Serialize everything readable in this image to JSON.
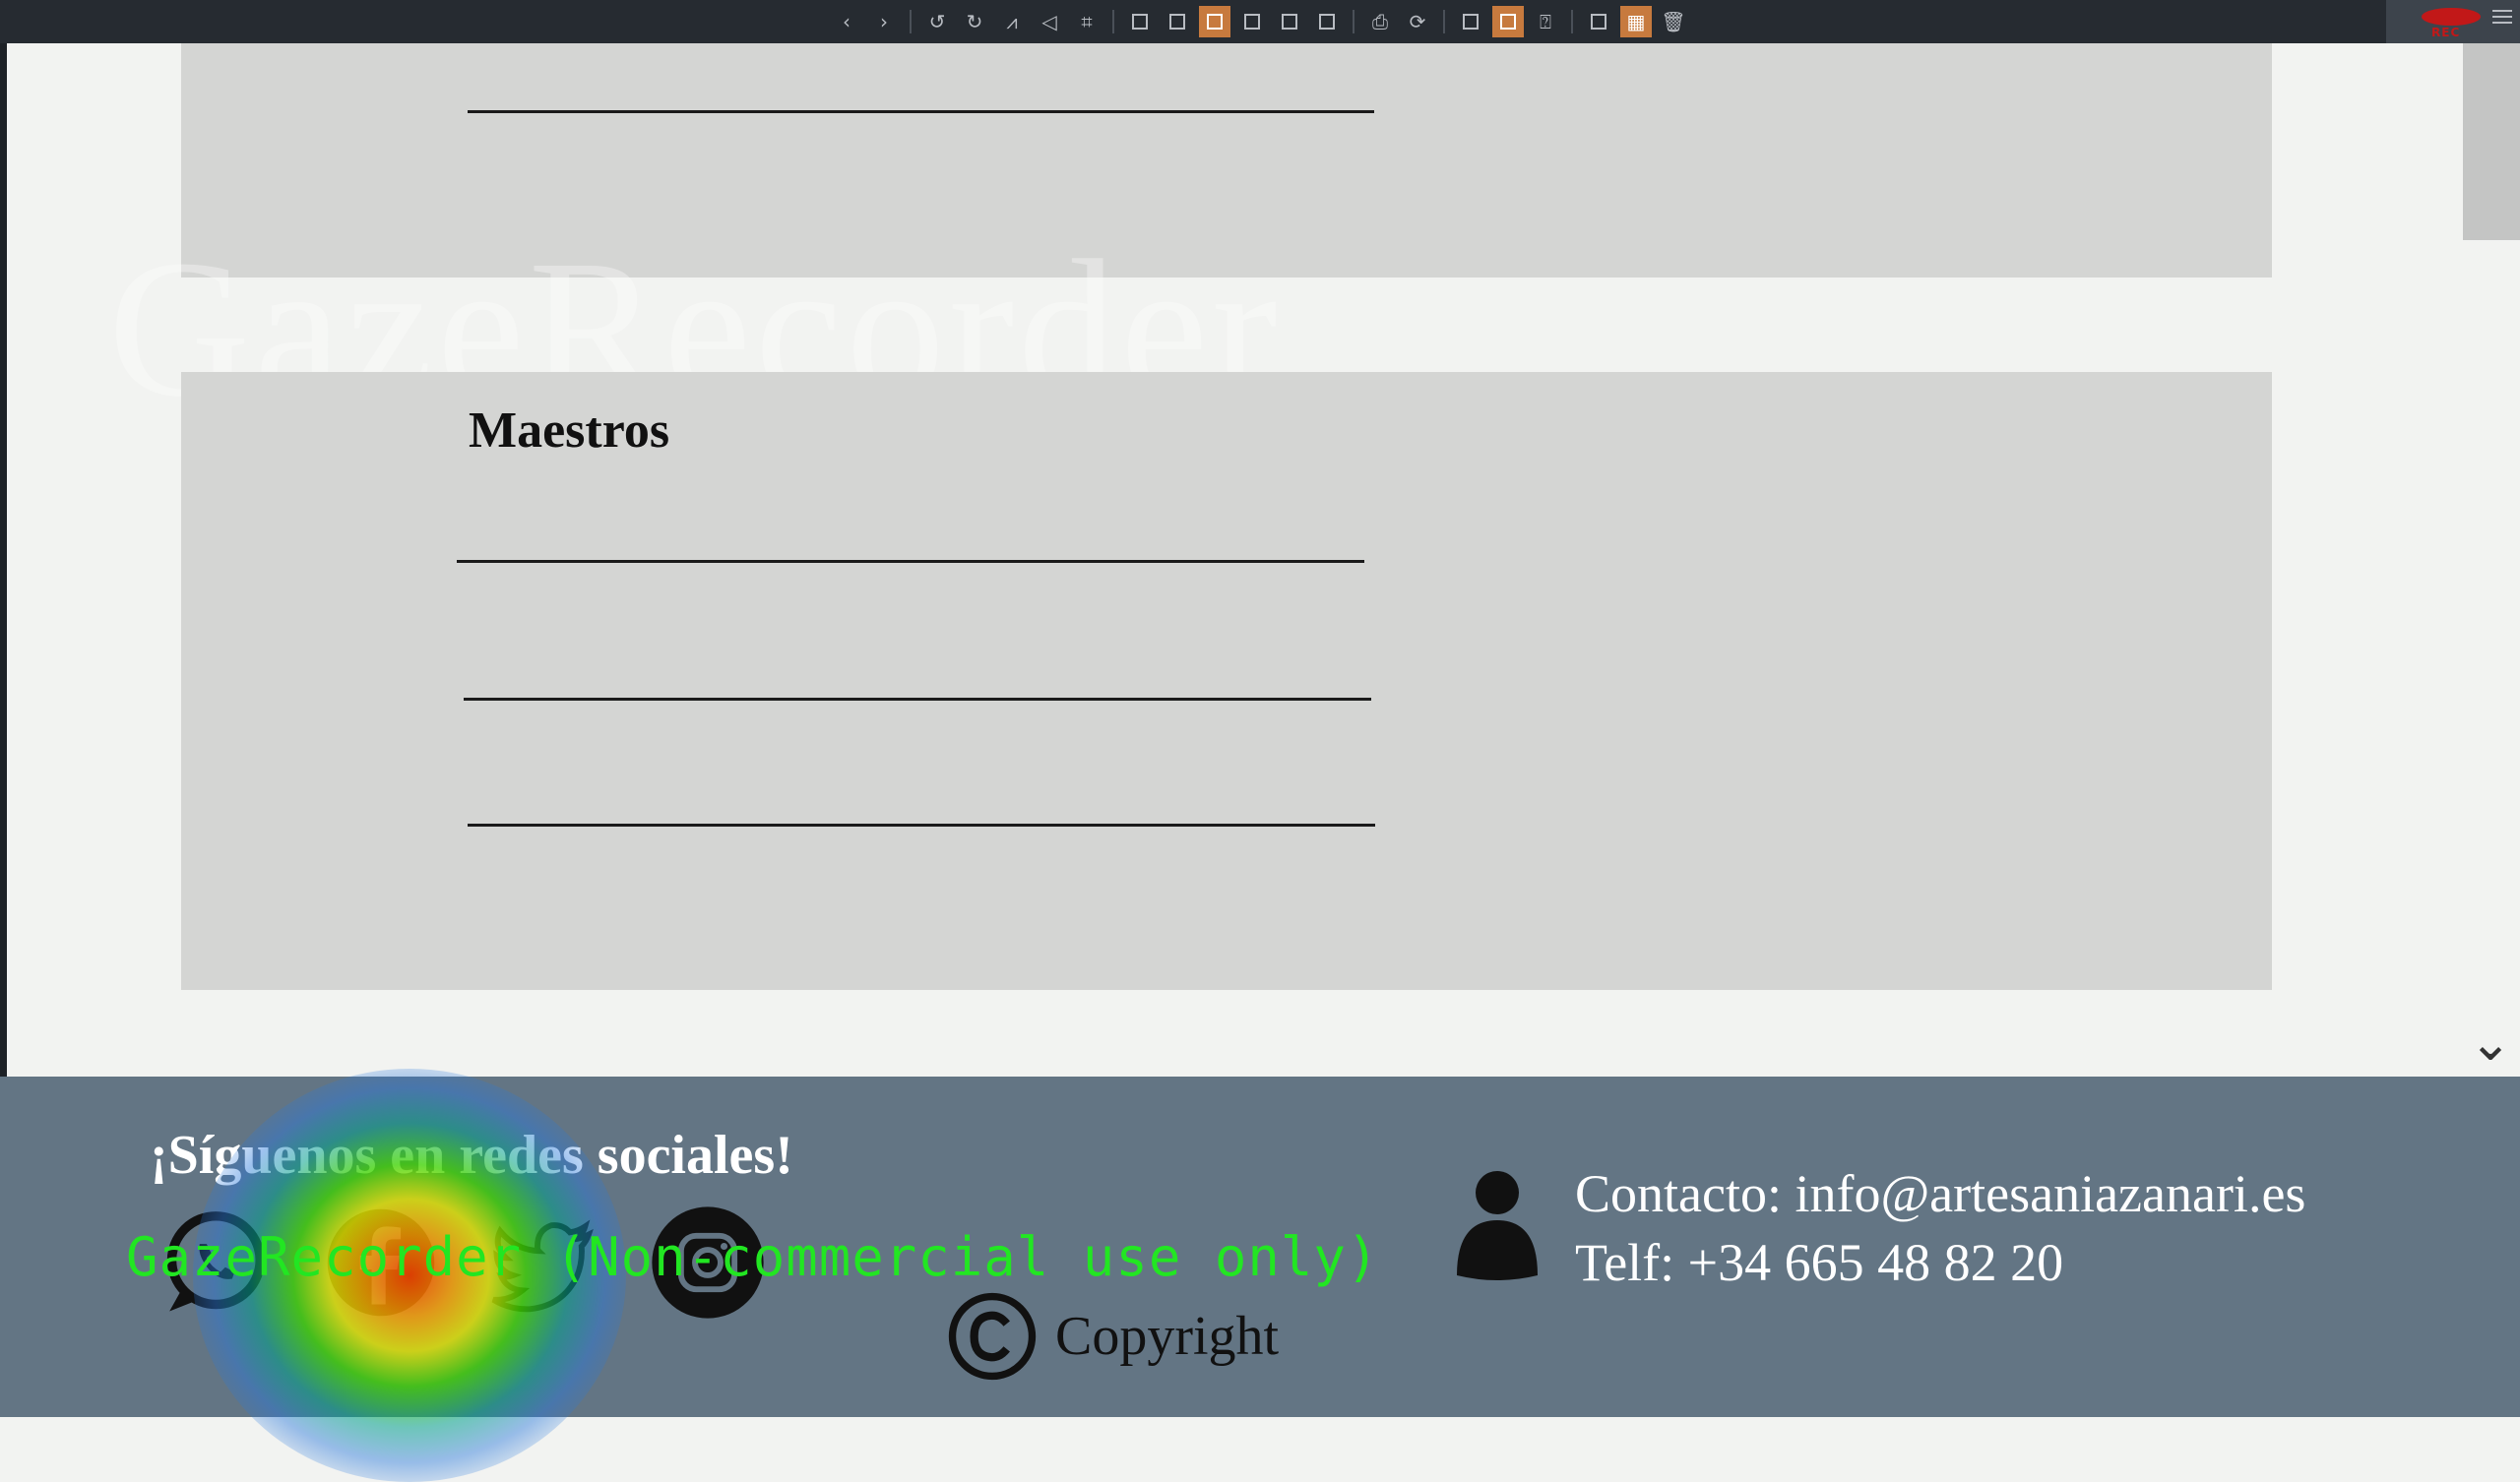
{
  "toolbar": {
    "buttons": [
      "back",
      "forward",
      "undo",
      "redo",
      "flip-horizontal",
      "flip-vertical",
      "crop",
      "frame",
      "lock",
      "image-active",
      "image-2",
      "image-3",
      "image-4",
      "print",
      "refresh",
      "resize",
      "expand-active",
      "chat",
      "picture",
      "grid-active",
      "trash"
    ]
  },
  "recorder": {
    "label": "REC"
  },
  "watermark": {
    "text": "GazeRecorder"
  },
  "card2": {
    "title": "Maestros"
  },
  "footer": {
    "follow_title": "¡Síguenos en redes sociales!",
    "contact_email": "Contacto: info@artesaniazanari.es",
    "contact_phone": "Telf: +34 665 48 82 20",
    "copyright": "Copyright"
  },
  "overlay": {
    "gaze_label": "GazeRecorder (Non-commercial use only)"
  },
  "colors": {
    "toolbar_bg": "#262b31",
    "card_bg": "#d4d5d3",
    "footer_bg": "#637584",
    "accent": "#c77a3e"
  }
}
